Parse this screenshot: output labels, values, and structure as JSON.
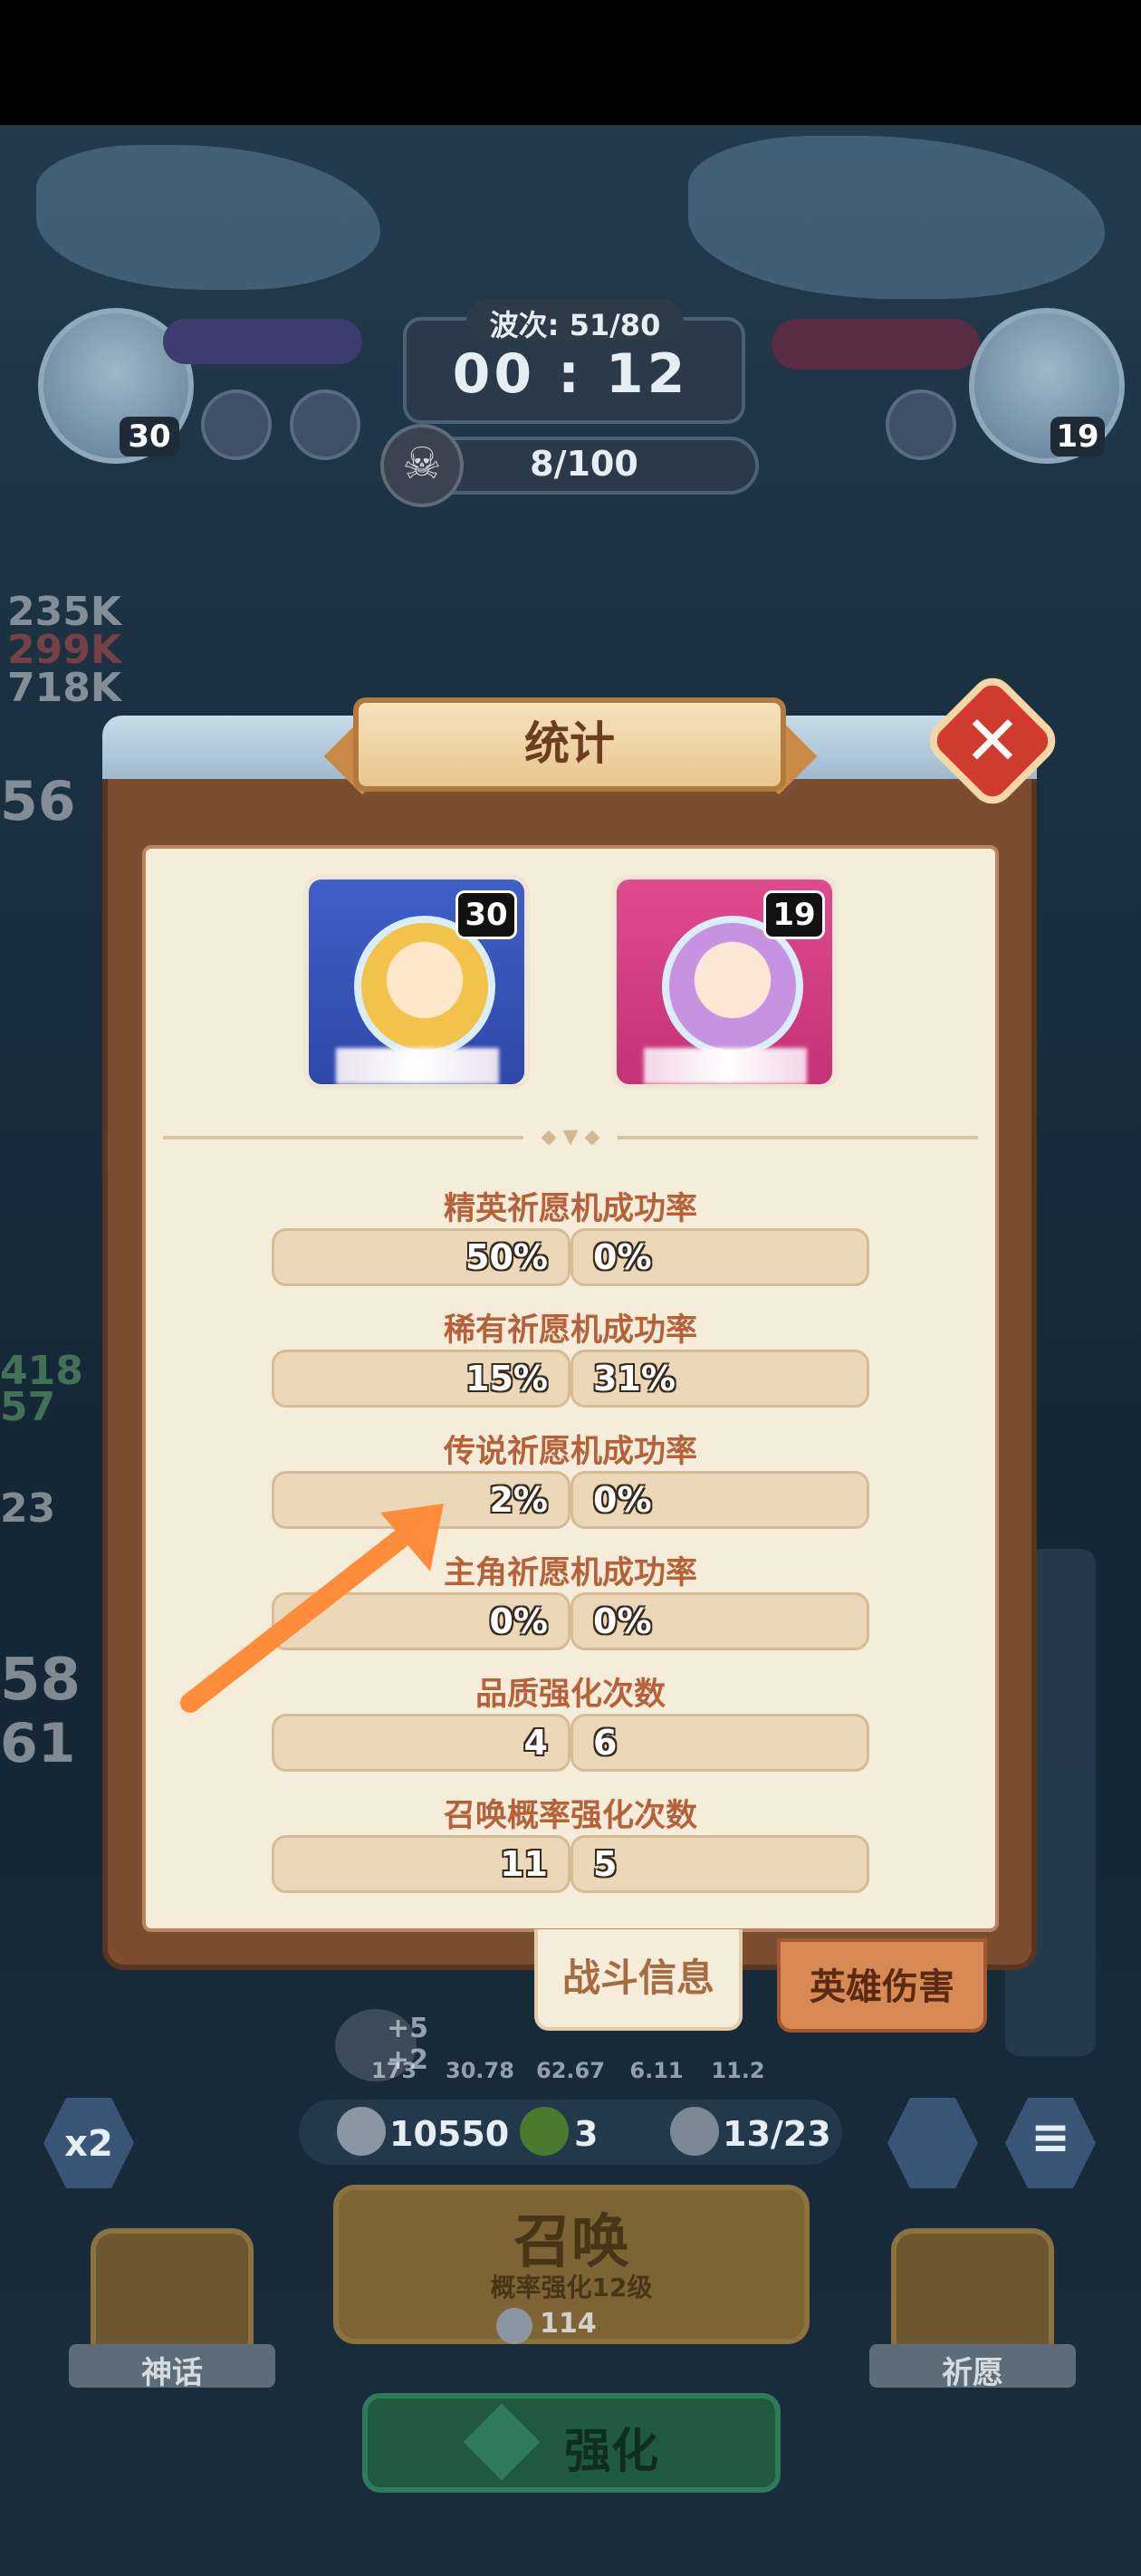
{
  "hud": {
    "wave_label": "波次: 51/80",
    "timer": "00 : 12",
    "kills": "8/100",
    "left_player_level": "30",
    "right_player_level": "19"
  },
  "side_numbers": [
    "235K",
    "299K",
    "718K",
    "56",
    "418",
    "57",
    "23",
    "58",
    "61"
  ],
  "dialog": {
    "title": "统计",
    "close_label": "✕",
    "player_left_level": "30",
    "player_right_level": "19",
    "stats": [
      {
        "label": "精英祈愿机成功率",
        "left": "50%",
        "right": "0%"
      },
      {
        "label": "稀有祈愿机成功率",
        "left": "15%",
        "right": "31%"
      },
      {
        "label": "传说祈愿机成功率",
        "left": "2%",
        "right": "0%"
      },
      {
        "label": "主角祈愿机成功率",
        "left": "0%",
        "right": "0%"
      },
      {
        "label": "品质强化次数",
        "left": "4",
        "right": "6"
      },
      {
        "label": "召唤概率强化次数",
        "left": "11",
        "right": "5"
      }
    ],
    "tabs": {
      "battle_info": "战斗信息",
      "hero_damage": "英雄伤害"
    }
  },
  "bottom": {
    "mini_stats": [
      "173",
      "30.78",
      "62.67",
      "6.11",
      "11.2"
    ],
    "mini_stat_prefix": "+5\n+2",
    "speed": "x2",
    "coins": "10550",
    "clovers": "3",
    "units": "13/23",
    "summon_title": "召唤",
    "summon_sub": "概率强化12级",
    "summon_cost": "114",
    "myth_label": "神话",
    "wish_label": "祈愿",
    "upgrade_label": "强化"
  },
  "colors": {
    "accent_close": "#cf3b2e",
    "panel": "#f5ecd9",
    "label": "#b5623a",
    "arrow": "#ff8c3a"
  }
}
